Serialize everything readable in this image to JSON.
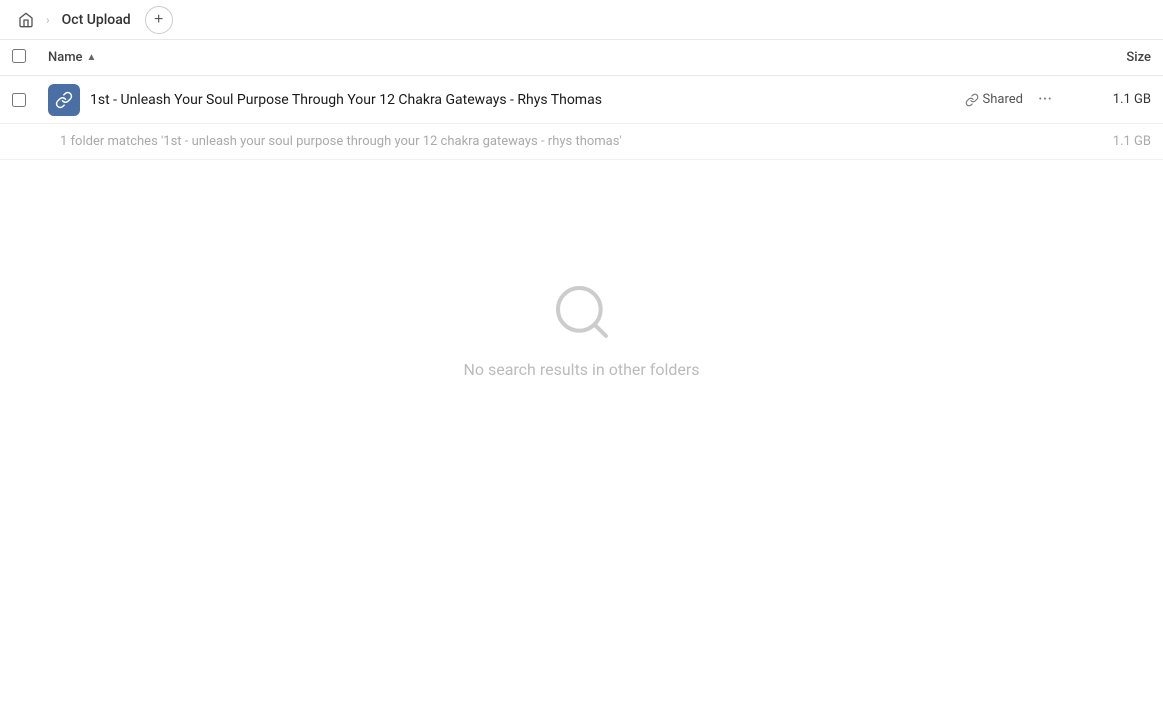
{
  "header": {
    "home_label": "Home",
    "breadcrumb_label": "Oct Upload",
    "add_button_label": "+"
  },
  "table": {
    "col_name_label": "Name",
    "col_size_label": "Size",
    "sort_direction": "asc"
  },
  "file_row": {
    "name": "1st - Unleash Your Soul Purpose Through Your 12 Chakra Gateways - Rhys Thomas",
    "shared_label": "Shared",
    "size": "1.1 GB",
    "more_label": "···"
  },
  "summary_row": {
    "text": "1 folder matches '1st - unleash your soul purpose through your 12 chakra gateways - rhys thomas'",
    "size": "1.1 GB"
  },
  "empty_state": {
    "label": "No search results in other folders"
  }
}
